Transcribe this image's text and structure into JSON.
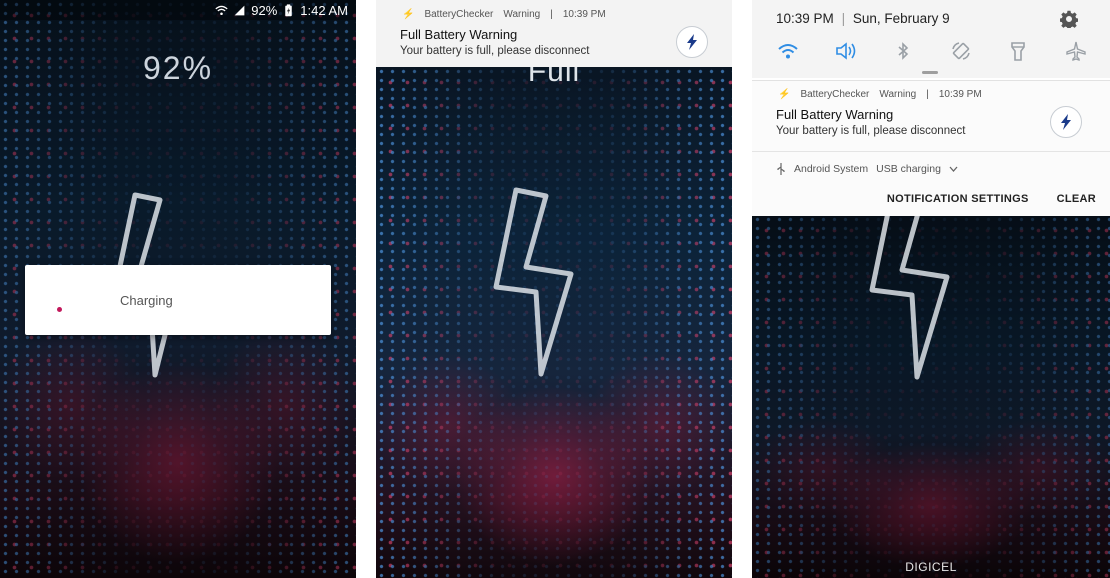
{
  "panel1": {
    "status": {
      "battery": "92%",
      "time": "1:42 AM"
    },
    "big_percent": "92%",
    "dialog": {
      "text": "Charging"
    }
  },
  "panel2": {
    "notification": {
      "app": "BatteryChecker",
      "category": "Warning",
      "separator": "|",
      "time": "10:39 PM",
      "title": "Full Battery Warning",
      "body": "Your battery is full, please disconnect"
    },
    "background_text": "Full"
  },
  "panel3": {
    "header": {
      "time": "10:39 PM",
      "separator": "|",
      "date": "Sun, February 9"
    },
    "quick_settings": [
      {
        "name": "wifi-icon",
        "active": true
      },
      {
        "name": "volume-icon",
        "active": true
      },
      {
        "name": "bluetooth-icon",
        "active": false
      },
      {
        "name": "auto-rotate-icon",
        "active": false
      },
      {
        "name": "flashlight-icon",
        "active": false
      },
      {
        "name": "airplane-mode-icon",
        "active": false
      }
    ],
    "notification": {
      "app": "BatteryChecker",
      "category": "Warning",
      "separator": "|",
      "time": "10:39 PM",
      "title": "Full Battery Warning",
      "body": "Your battery is full, please disconnect"
    },
    "usb": {
      "app": "Android System",
      "text": "USB charging"
    },
    "actions": {
      "settings": "NOTIFICATION SETTINGS",
      "clear": "CLEAR"
    },
    "carrier": "DIGICEL"
  },
  "colors": {
    "accent": "#2f8de4",
    "spinner": "#c2185b",
    "card_bg": "#f3f3f3"
  }
}
